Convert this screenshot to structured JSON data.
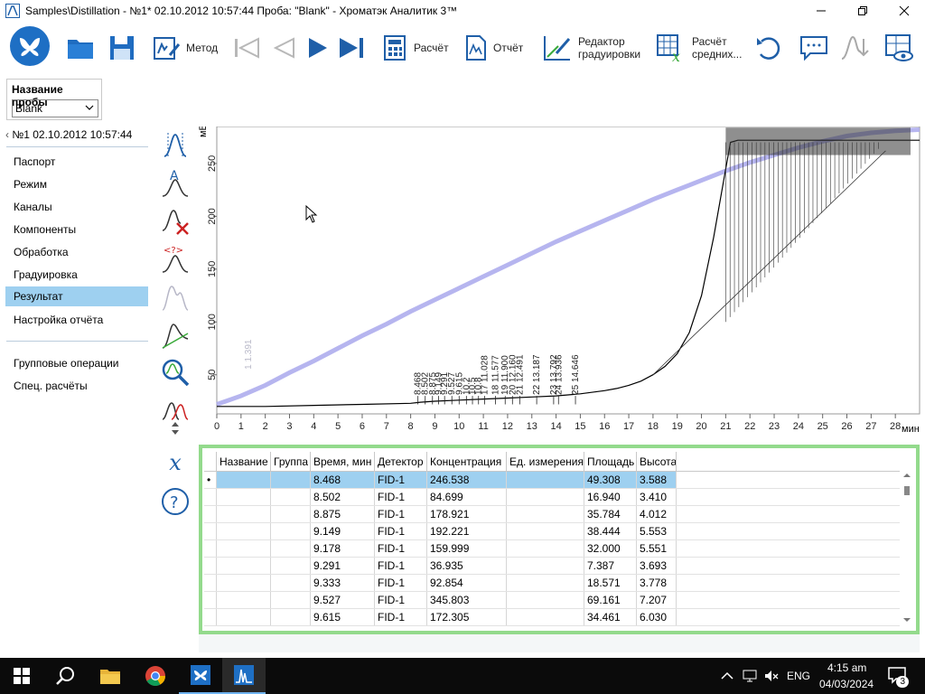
{
  "window": {
    "title": "Samples\\Distillation - №1* 02.10.2012 10:57:44      Проба: \"Blank\" - Хроматэк Аналитик 3™"
  },
  "toolbar": {
    "method_label": "Метод",
    "calc_label": "Расчёт",
    "report_label": "Отчёт",
    "calib_editor_line1": "Редактор",
    "calib_editor_line2": "градуировки",
    "avg_calc_line1": "Расчёт",
    "avg_calc_line2": "средних..."
  },
  "sample": {
    "label": "Название пробы",
    "selected": "Blank"
  },
  "sidebar": {
    "back_link": "№1 02.10.2012 10:57:44",
    "items": [
      {
        "label": "Паспорт"
      },
      {
        "label": "Режим"
      },
      {
        "label": "Каналы"
      },
      {
        "label": "Компоненты"
      },
      {
        "label": "Обработка"
      },
      {
        "label": "Градуировка"
      },
      {
        "label": "Результат"
      },
      {
        "label": "Настройка отчёта"
      }
    ],
    "extra_items": [
      {
        "label": "Групповые операции"
      },
      {
        "label": "Спец. расчёты"
      }
    ],
    "active_index": 6
  },
  "chart_data": {
    "type": "line",
    "ylabel": "мВ",
    "xlabel": "мин",
    "xlim": [
      0,
      29
    ],
    "ylim": [
      13,
      285
    ],
    "x_ticks": [
      0,
      1,
      2,
      3,
      4,
      5,
      6,
      7,
      8,
      9,
      10,
      11,
      12,
      13,
      14,
      15,
      16,
      17,
      18,
      19,
      20,
      21,
      22,
      23,
      24,
      25,
      26,
      27,
      28
    ],
    "y_ticks": [
      50,
      100,
      150,
      200,
      250
    ],
    "series": [
      {
        "color": "#a9a8ec",
        "x": [
          0,
          1,
          2,
          3,
          4,
          5,
          6,
          7,
          8,
          9,
          10,
          11,
          12,
          13,
          14,
          15,
          16,
          17,
          18,
          19,
          20,
          21,
          22,
          23,
          24,
          25,
          26,
          27,
          28,
          29
        ],
        "y": [
          22,
          30,
          40,
          52,
          63,
          75,
          87,
          98,
          110,
          121,
          132,
          143,
          154,
          165,
          176,
          186,
          196,
          206,
          216,
          225,
          234,
          243,
          251,
          258,
          265,
          271,
          276,
          279,
          281,
          282
        ]
      },
      {
        "color": "#000000",
        "x": [
          0,
          2,
          4,
          6,
          8,
          8.4,
          9,
          10,
          11,
          12,
          13,
          14,
          15,
          16,
          16.5,
          17,
          17.5,
          18,
          18.5,
          19,
          19.5,
          20,
          20.5,
          21,
          21.2,
          21.5,
          22,
          24,
          26,
          28,
          29
        ],
        "y": [
          20,
          20,
          21,
          22,
          23,
          24,
          25,
          26,
          27,
          28,
          29,
          30,
          32,
          35,
          37,
          40,
          44,
          50,
          58,
          70,
          90,
          125,
          180,
          245,
          270,
          272,
          272,
          272,
          272,
          272,
          272
        ]
      }
    ],
    "peak_labels": [
      {
        "x": 8.3,
        "text": "8.468"
      },
      {
        "x": 8.6,
        "text": "8.502"
      },
      {
        "x": 8.9,
        "text": "8.875"
      },
      {
        "x": 9.15,
        "text": "9.149"
      },
      {
        "x": 9.4,
        "text": "9.291"
      },
      {
        "x": 9.7,
        "text": "9.527"
      },
      {
        "x": 10.0,
        "text": "9.615"
      },
      {
        "x": 10.3,
        "text": "10.2"
      },
      {
        "x": 10.55,
        "text": "10.5"
      },
      {
        "x": 10.8,
        "text": "10.8"
      },
      {
        "x": 11.05,
        "text": "17 11.028"
      },
      {
        "x": 11.5,
        "text": "18 11.577"
      },
      {
        "x": 11.9,
        "text": "19 11.900"
      },
      {
        "x": 12.2,
        "text": "20 12.160"
      },
      {
        "x": 12.5,
        "text": "21 12.491"
      },
      {
        "x": 13.2,
        "text": "22 13.187"
      },
      {
        "x": 13.9,
        "text": "23 13.792"
      },
      {
        "x": 14.1,
        "text": "24 13.936"
      },
      {
        "x": 14.8,
        "text": "25 14.646"
      }
    ],
    "annotations": [
      {
        "x": 1.3,
        "text": "1 1.391"
      }
    ]
  },
  "table": {
    "columns": [
      "Название",
      "Группа",
      "Время, мин",
      "Детектор",
      "Концентрация",
      "Ед. измерения",
      "Площадь",
      "Высота"
    ],
    "rows": [
      {
        "marker": "•",
        "name": "",
        "group": "",
        "time": "8.468",
        "detector": "FID-1",
        "conc": "246.538",
        "unit": "",
        "area": "49.308",
        "height": "3.588"
      },
      {
        "marker": "",
        "name": "",
        "group": "",
        "time": "8.502",
        "detector": "FID-1",
        "conc": "84.699",
        "unit": "",
        "area": "16.940",
        "height": "3.410"
      },
      {
        "marker": "",
        "name": "",
        "group": "",
        "time": "8.875",
        "detector": "FID-1",
        "conc": "178.921",
        "unit": "",
        "area": "35.784",
        "height": "4.012"
      },
      {
        "marker": "",
        "name": "",
        "group": "",
        "time": "9.149",
        "detector": "FID-1",
        "conc": "192.221",
        "unit": "",
        "area": "38.444",
        "height": "5.553"
      },
      {
        "marker": "",
        "name": "",
        "group": "",
        "time": "9.178",
        "detector": "FID-1",
        "conc": "159.999",
        "unit": "",
        "area": "32.000",
        "height": "5.551"
      },
      {
        "marker": "",
        "name": "",
        "group": "",
        "time": "9.291",
        "detector": "FID-1",
        "conc": "36.935",
        "unit": "",
        "area": "7.387",
        "height": "3.693"
      },
      {
        "marker": "",
        "name": "",
        "group": "",
        "time": "9.333",
        "detector": "FID-1",
        "conc": "92.854",
        "unit": "",
        "area": "18.571",
        "height": "3.778"
      },
      {
        "marker": "",
        "name": "",
        "group": "",
        "time": "9.527",
        "detector": "FID-1",
        "conc": "345.803",
        "unit": "",
        "area": "69.161",
        "height": "7.207"
      },
      {
        "marker": "",
        "name": "",
        "group": "",
        "time": "9.615",
        "detector": "FID-1",
        "conc": "172.305",
        "unit": "",
        "area": "34.461",
        "height": "6.030"
      }
    ]
  },
  "taskbar": {
    "language": "ENG",
    "time": "4:15 am",
    "date": "04/03/2024",
    "notification_count": "3"
  },
  "colors": {
    "accent": "#1e6fc4",
    "selection": "#9ed0f0",
    "table_border": "#93da8c",
    "baseline_signal": "#a9a8ec"
  }
}
